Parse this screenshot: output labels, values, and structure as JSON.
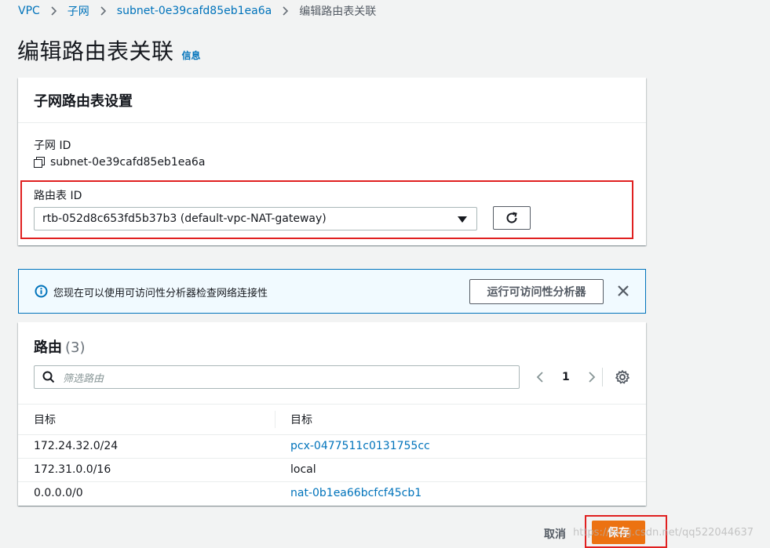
{
  "breadcrumb": {
    "items": [
      "VPC",
      "子网",
      "subnet-0e39cafd85eb1ea6a"
    ],
    "current": "编辑路由表关联"
  },
  "page": {
    "title": "编辑路由表关联",
    "info_link": "信息"
  },
  "settings": {
    "header": "子网路由表设置",
    "subnet_label": "子网 ID",
    "subnet_value": "subnet-0e39cafd85eb1ea6a",
    "route_table_label": "路由表 ID",
    "route_table_selected": "rtb-052d8c653fd5b37b3 (default-vpc-NAT-gateway)"
  },
  "alert": {
    "text": "您现在可以使用可访问性分析器检查网络连接性",
    "button": "运行可访问性分析器"
  },
  "routes": {
    "title": "路由",
    "count": "(3)",
    "filter_placeholder": "筛选路由",
    "page": "1",
    "columns": [
      "目标",
      "目标"
    ],
    "rows": [
      [
        "172.24.32.0/24",
        "pcx-0477511c0131755cc"
      ],
      [
        "172.31.0.0/16",
        "local"
      ],
      [
        "0.0.0.0/0",
        "nat-0b1ea66bcfcf45cb1"
      ]
    ]
  },
  "footer": {
    "cancel": "取消",
    "save": "保存"
  },
  "watermark": "https://blog.csdn.net/qq522044637",
  "colors": {
    "link": "#0073bb",
    "primary": "#ec7211",
    "highlight": "#e02020"
  }
}
